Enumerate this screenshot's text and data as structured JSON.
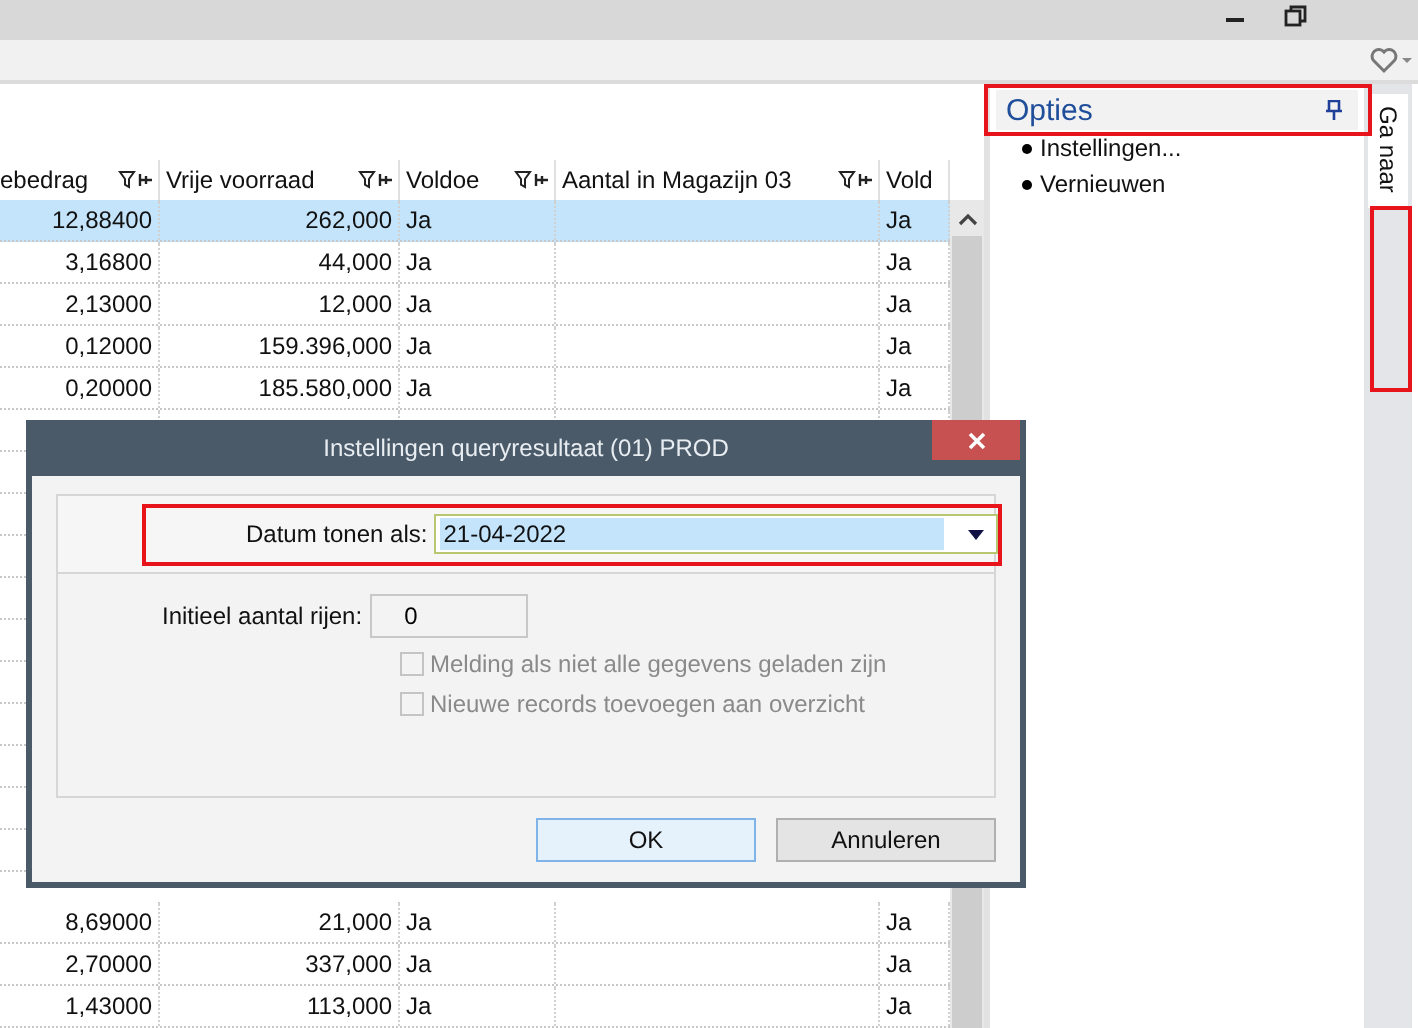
{
  "table": {
    "columns": [
      {
        "label": "ebedrag",
        "filter": true
      },
      {
        "label": "Vrije voorraad",
        "filter": true
      },
      {
        "label": "Voldoe",
        "filter": true
      },
      {
        "label": "Aantal in Magazijn 03",
        "filter": true
      },
      {
        "label": "Vold",
        "filter": false
      }
    ],
    "rows_top": [
      {
        "cells": [
          "12,88400",
          "262,000",
          "Ja",
          "",
          "Ja"
        ],
        "selected": true
      },
      {
        "cells": [
          "3,16800",
          "44,000",
          "Ja",
          "",
          "Ja"
        ],
        "selected": false
      },
      {
        "cells": [
          "2,13000",
          "12,000",
          "Ja",
          "",
          "Ja"
        ],
        "selected": false
      },
      {
        "cells": [
          "0,12000",
          "159.396,000",
          "Ja",
          "",
          "Ja"
        ],
        "selected": false
      },
      {
        "cells": [
          "0,20000",
          "185.580,000",
          "Ja",
          "",
          "Ja"
        ],
        "selected": false
      }
    ],
    "rows_bottom": [
      {
        "cells": [
          "8,69000",
          "21,000",
          "Ja",
          "",
          "Ja"
        ],
        "selected": false
      },
      {
        "cells": [
          "2,70000",
          "337,000",
          "Ja",
          "",
          "Ja"
        ],
        "selected": false
      },
      {
        "cells": [
          "1,43000",
          "113,000",
          "Ja",
          "",
          "Ja"
        ],
        "selected": false
      }
    ]
  },
  "options_panel": {
    "title": "Opties",
    "items": [
      "Instellingen...",
      "Vernieuwen"
    ]
  },
  "side_tab": {
    "label": "Ga naar"
  },
  "dialog": {
    "title": "Instellingen queryresultaat (01)  PROD",
    "date_field": {
      "label": "Datum tonen als:",
      "value": "21-04-2022"
    },
    "rows_field": {
      "label": "Initieel aantal rijen:",
      "value": "0"
    },
    "checkboxes": [
      {
        "label": "Melding als niet alle gegevens geladen zijn",
        "checked": false,
        "disabled": true
      },
      {
        "label": "Nieuwe records toevoegen aan overzicht",
        "checked": false,
        "disabled": true
      }
    ],
    "buttons": [
      {
        "label": "OK",
        "default": true
      },
      {
        "label": "Annuleren",
        "default": false
      }
    ]
  }
}
